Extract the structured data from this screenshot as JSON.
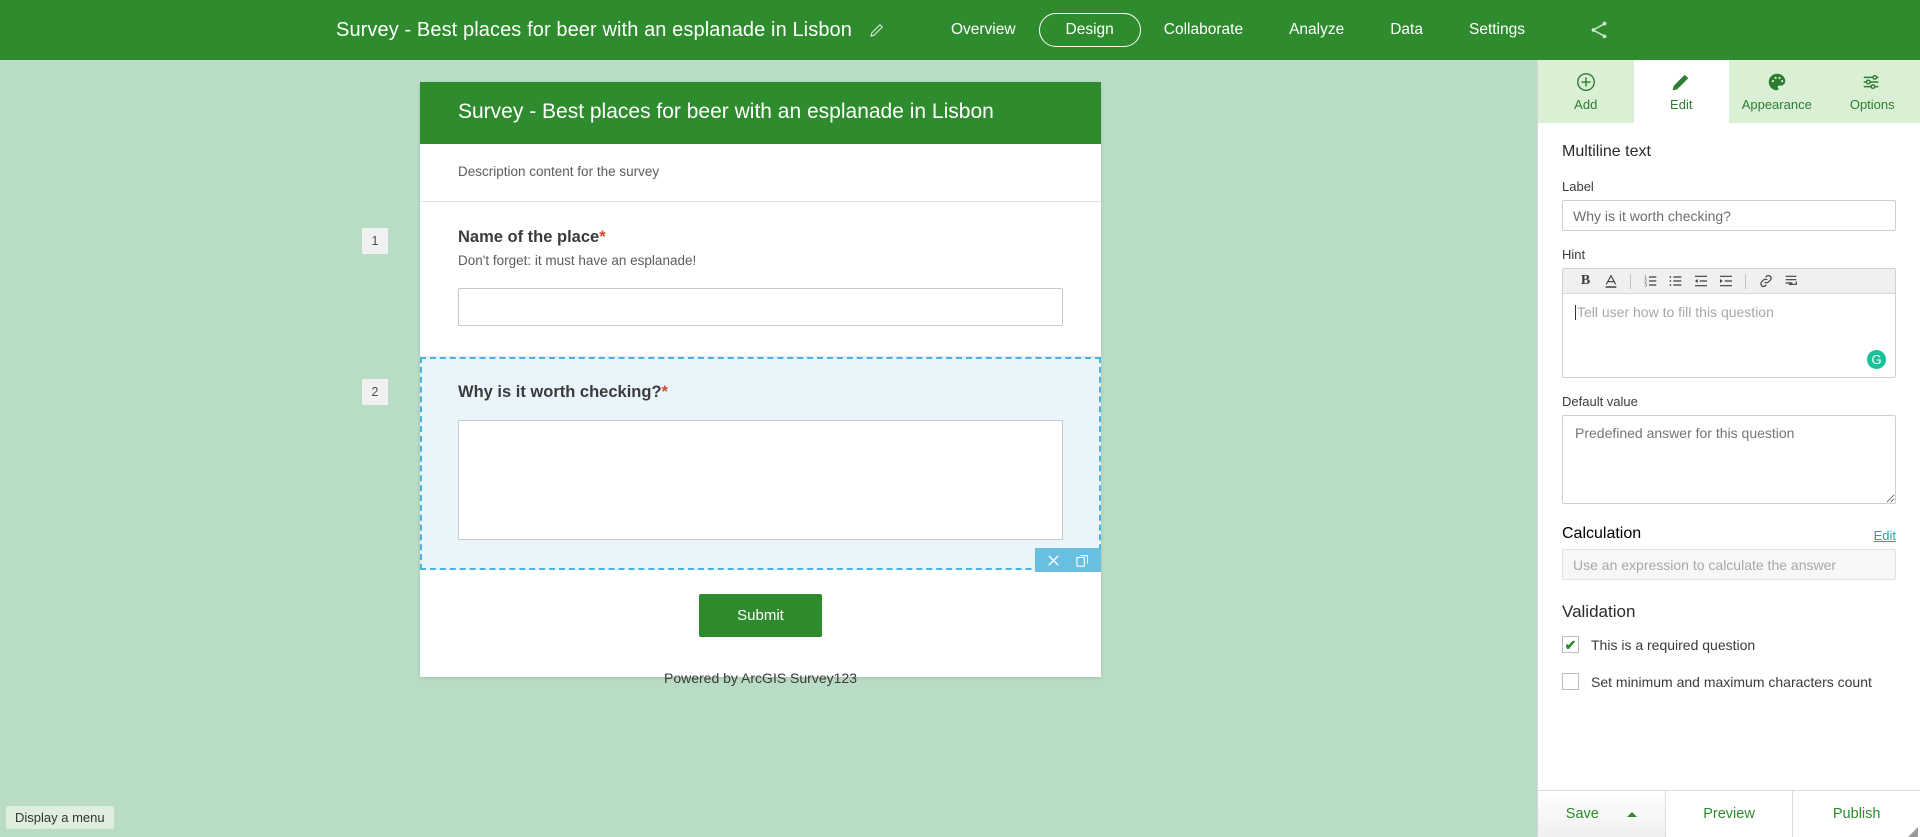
{
  "header": {
    "title": "Survey - Best places for beer with an esplanade in Lisbon",
    "edit_icon": "pencil-icon",
    "share_icon": "share-icon",
    "nav": [
      {
        "label": "Overview",
        "active": false
      },
      {
        "label": "Design",
        "active": true
      },
      {
        "label": "Collaborate",
        "active": false
      },
      {
        "label": "Analyze",
        "active": false
      },
      {
        "label": "Data",
        "active": false
      },
      {
        "label": "Settings",
        "active": false
      }
    ]
  },
  "survey": {
    "title": "Survey - Best places for beer with an esplanade in Lisbon",
    "description": "Description content for the survey",
    "questions": [
      {
        "number": "1",
        "label": "Name of the place",
        "required_mark": "*",
        "hint": "Don't forget: it must have an esplanade!",
        "type": "single-line"
      },
      {
        "number": "2",
        "label": "Why is it worth checking?",
        "required_mark": "*",
        "hint": "",
        "type": "multiline",
        "selected": true,
        "actions": [
          {
            "name": "delete-question-icon",
            "glyph": "✕"
          },
          {
            "name": "duplicate-question-icon",
            "glyph": "⧉"
          }
        ]
      }
    ],
    "submit_label": "Submit",
    "powered_by": "Powered by ArcGIS Survey123"
  },
  "status_tip": "Display a menu",
  "panel": {
    "tabs": [
      {
        "label": "Add",
        "icon": "plus-circle-icon",
        "active": false
      },
      {
        "label": "Edit",
        "icon": "pencil-icon",
        "active": true
      },
      {
        "label": "Appearance",
        "icon": "palette-icon",
        "active": false
      },
      {
        "label": "Options",
        "icon": "sliders-icon",
        "active": false
      }
    ],
    "question_type": "Multiline text",
    "label_field": {
      "label": "Label",
      "value": "Why is it worth checking?"
    },
    "hint_field": {
      "label": "Hint",
      "placeholder": "Tell user how to fill this question",
      "toolbar": [
        {
          "name": "bold-icon",
          "glyph": "B"
        },
        {
          "name": "font-color-icon",
          "glyph": "A"
        },
        {
          "name": "numbered-list-icon",
          "glyph": ""
        },
        {
          "name": "bulleted-list-icon",
          "glyph": ""
        },
        {
          "name": "decrease-indent-icon",
          "glyph": ""
        },
        {
          "name": "increase-indent-icon",
          "glyph": ""
        },
        {
          "name": "link-icon",
          "glyph": ""
        },
        {
          "name": "source-code-icon",
          "glyph": ""
        }
      ],
      "assistant_badge": "G"
    },
    "default_value_field": {
      "label": "Default value",
      "placeholder": "Predefined answer for this question"
    },
    "calculation_field": {
      "label": "Calculation",
      "edit_link": "Edit",
      "placeholder": "Use an expression to calculate the answer"
    },
    "validation": {
      "title": "Validation",
      "items": [
        {
          "label": "This is a required question",
          "checked": true
        },
        {
          "label": "Set minimum and maximum characters count",
          "checked": false
        }
      ]
    },
    "footer": {
      "save_label": "Save",
      "preview_label": "Preview",
      "publish_label": "Publish"
    }
  },
  "colors": {
    "brand_green": "#2e8b2e",
    "canvas_green": "#b9dcc4",
    "panel_tab_green": "#d9f0d5",
    "selection_blue": "#4ab3e3",
    "selection_fill": "#eaf5fb",
    "required_red": "#d9472b",
    "link_teal": "#2e9ab8",
    "grammarly_green": "#15c39a"
  }
}
